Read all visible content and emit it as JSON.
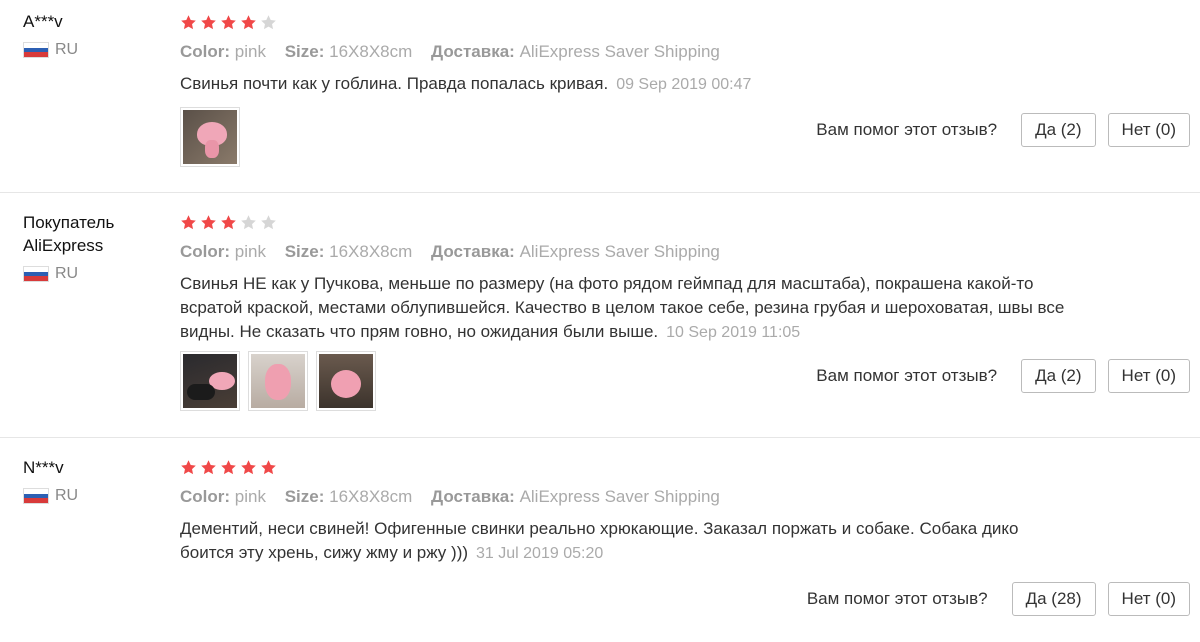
{
  "labels": {
    "color_key": "Color:",
    "size_key": "Size:",
    "shipping_key": "Доставка:",
    "helpful_question": "Вам помог этот отзыв?"
  },
  "colors": {
    "star_filled": "#f04848",
    "star_empty": "#d6d6d6",
    "flag_white": "#ffffff",
    "flag_blue": "#2c5fb3",
    "flag_red": "#d83a3a"
  },
  "reviews": [
    {
      "user": "A***v",
      "country": "RU",
      "rating": 4,
      "color": "pink",
      "size": "16X8X8cm",
      "shipping": "AliExpress Saver Shipping",
      "text": "Свинья почти как у гоблина. Правда попалась кривая.",
      "date": "09 Sep 2019 00:47",
      "photo_count": 1,
      "yes_label": "Да (2)",
      "no_label": "Нет (0)"
    },
    {
      "user": "Покупатель AliExpress",
      "country": "RU",
      "rating": 3,
      "color": "pink",
      "size": "16X8X8cm",
      "shipping": "AliExpress Saver Shipping",
      "text": "Свинья НЕ как у Пучкова, меньше по размеру (на фото рядом геймпад для масштаба), покрашена какой-то всратой краской, местами облупившейся. Качество в целом такое себе, резина грубая и шероховатая, швы все видны. Не сказать что прям говно, но ожидания были выше.",
      "date": "10 Sep 2019 11:05",
      "photo_count": 3,
      "yes_label": "Да (2)",
      "no_label": "Нет (0)"
    },
    {
      "user": "N***v",
      "country": "RU",
      "rating": 5,
      "color": "pink",
      "size": "16X8X8cm",
      "shipping": "AliExpress Saver Shipping",
      "text": "Дементий, неси свиней! Офигенные свинки реально хрюкающие. Заказал поржать и собаке. Собака дико боится эту хрень, сижу жму и ржу )))",
      "date": "31 Jul 2019 05:20",
      "photo_count": 0,
      "yes_label": "Да (28)",
      "no_label": "Нет (0)"
    }
  ]
}
